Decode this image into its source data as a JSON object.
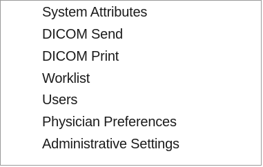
{
  "menu": {
    "items": [
      {
        "label": "System Attributes"
      },
      {
        "label": "DICOM Send"
      },
      {
        "label": "DICOM Print"
      },
      {
        "label": "Worklist"
      },
      {
        "label": "Users"
      },
      {
        "label": "Physician Preferences"
      },
      {
        "label": "Administrative Settings"
      }
    ]
  }
}
